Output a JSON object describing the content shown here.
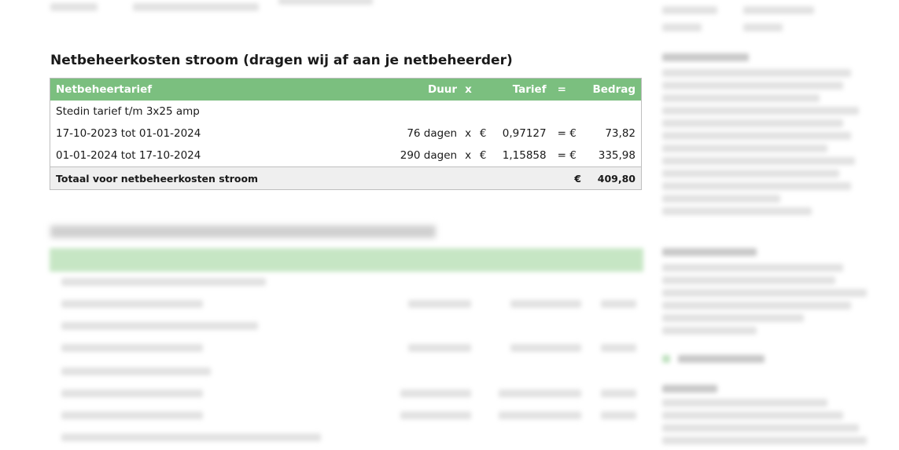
{
  "section": {
    "title": "Netbeheerkosten stroom (dragen wij af aan je netbeheerder)"
  },
  "table": {
    "headers": {
      "tariff": "Netbeheertarief",
      "duration": "Duur",
      "times": "x",
      "rate": "Tarief",
      "equals": "=",
      "amount": "Bedrag"
    },
    "rows": [
      {
        "label": "Stedin tarief t/m 3x25 amp",
        "duration": "",
        "times": "",
        "currency": "",
        "rate": "",
        "equals": "",
        "amount": ""
      },
      {
        "label": "17-10-2023 tot 01-01-2024",
        "duration": "76 dagen",
        "times": "x",
        "currency": "€",
        "rate": "0,97127",
        "equals": "= €",
        "amount": "73,82"
      },
      {
        "label": "01-01-2024 tot 17-10-2024",
        "duration": "290 dagen",
        "times": "x",
        "currency": "€",
        "rate": "1,15858",
        "equals": "= €",
        "amount": "335,98"
      }
    ],
    "total": {
      "label": "Totaal voor netbeheerkosten stroom",
      "currency": "€",
      "amount": "409,80"
    }
  }
}
